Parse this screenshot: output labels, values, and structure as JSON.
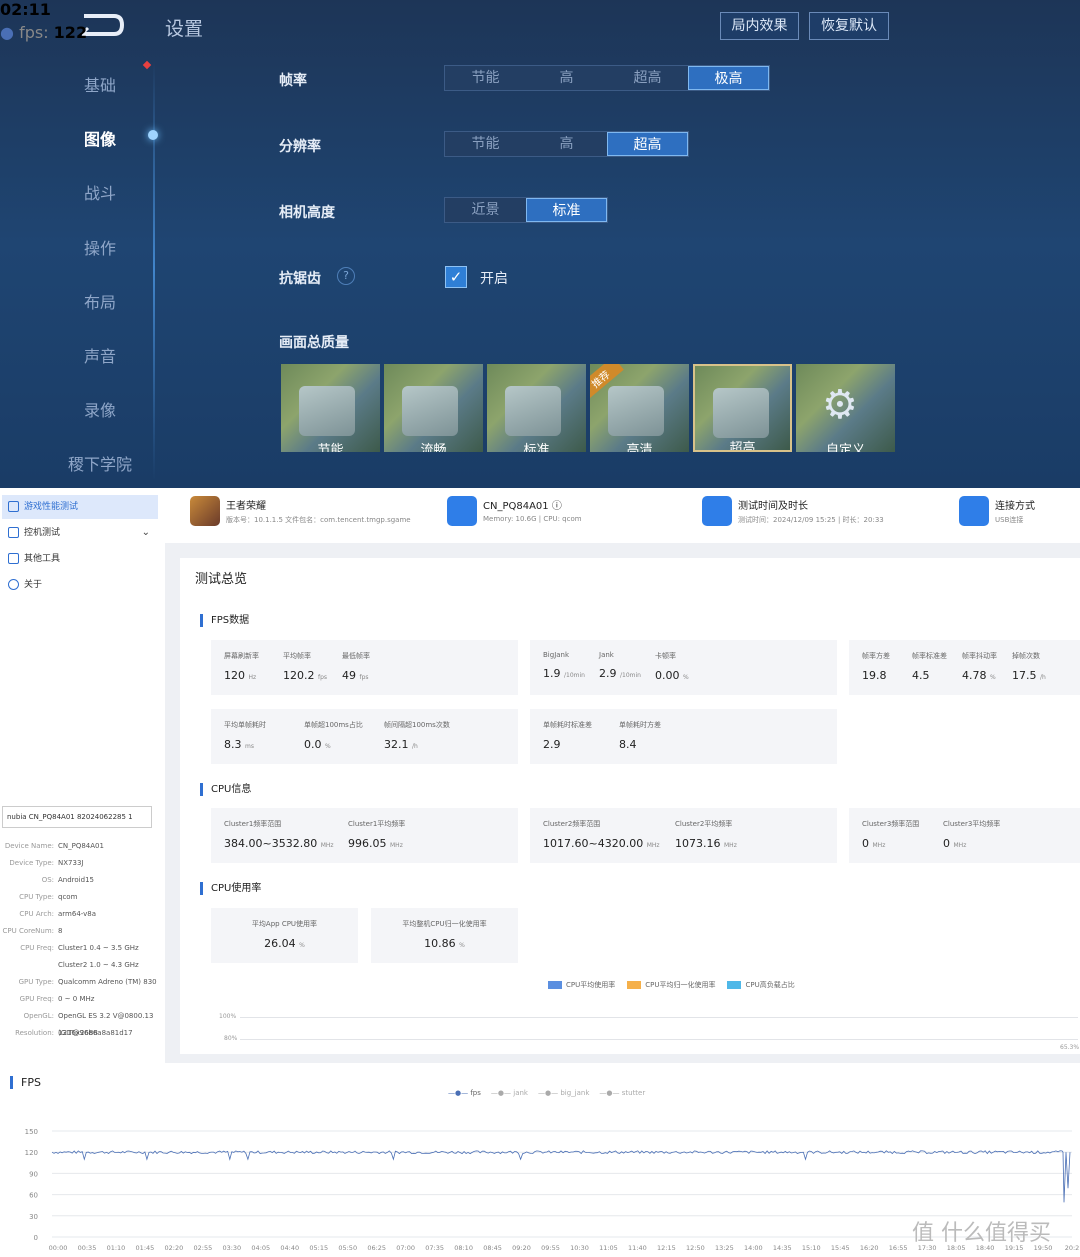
{
  "game": {
    "title": "设置",
    "top_buttons": [
      "局内效果",
      "恢复默认"
    ],
    "nav": [
      "基础",
      "图像",
      "战斗",
      "操作",
      "布局",
      "声音",
      "录像",
      "稷下学院"
    ],
    "active_nav": "图像",
    "settings": [
      {
        "label": "帧率",
        "options": [
          "节能",
          "高",
          "超高",
          "极高"
        ],
        "selected": "极高"
      },
      {
        "label": "分辨率",
        "options": [
          "节能",
          "高",
          "超高"
        ],
        "selected": "超高"
      },
      {
        "label": "相机高度",
        "options": [
          "近景",
          "标准"
        ],
        "selected": "标准"
      }
    ],
    "antialias": {
      "label": "抗锯齿",
      "help": "?",
      "checked": true,
      "value_label": "开启"
    },
    "quality": {
      "label": "画面总质量",
      "presets": [
        "节能",
        "流畅",
        "标准",
        "高清",
        "超高",
        "自定义"
      ],
      "selected": "超高",
      "recommended_badge": "推荐"
    }
  },
  "perf": {
    "sidebar": {
      "items": [
        "游戏性能测试",
        "控机测试",
        "其他工具",
        "关于"
      ],
      "active": "游戏性能测试",
      "device_select": "nubia CN_PQ84A01 82024062285 1",
      "device_info": [
        {
          "k": "Device Name:",
          "v": "CN_PQ84A01"
        },
        {
          "k": "Device Type:",
          "v": "NX733J"
        },
        {
          "k": "OS:",
          "v": "Android15"
        },
        {
          "k": "CPU Type:",
          "v": "qcom"
        },
        {
          "k": "CPU Arch:",
          "v": "arm64-v8a"
        },
        {
          "k": "CPU CoreNum:",
          "v": "8"
        },
        {
          "k": "CPU Freq:",
          "v": "Cluster1 0.4 ~ 3.5 GHz"
        },
        {
          "k": "",
          "v": "Cluster2 1.0 ~ 4.3 GHz"
        },
        {
          "k": "GPU Type:",
          "v": "Qualcomm Adreno (TM) 830"
        },
        {
          "k": "GPU Freq:",
          "v": "0 ~ 0 MHz"
        },
        {
          "k": "OpenGL:",
          "v": "OpenGL ES 3.2 V@0800.13 (GIT@96b6a8a81d17"
        },
        {
          "k": "Resolution:",
          "v": "1216x2688"
        }
      ]
    },
    "header": [
      {
        "title": "王者荣耀",
        "sub": "版本号：10.1.1.5    文件包名：com.tencent.tmgp.sgame",
        "icon": "game-avatar-icon"
      },
      {
        "title": "CN_PQ84A01 ⓘ",
        "sub": "Memory: 10.6G  |  CPU: qcom",
        "icon": "phone-icon"
      },
      {
        "title": "测试时间及时长",
        "sub": "测试时间：2024/12/09 15:25  |  时长：20:33",
        "icon": "clock-icon"
      },
      {
        "title": "连接方式",
        "sub": "USB连接",
        "icon": "usb-icon"
      }
    ],
    "overview_title": "测试总览",
    "fps_section": "FPS数据",
    "fps_metrics": {
      "box1": [
        {
          "label": "屏幕刷新率",
          "value": "120",
          "unit": "Hz"
        },
        {
          "label": "平均帧率",
          "value": "120.2",
          "unit": "fps"
        },
        {
          "label": "最低帧率",
          "value": "49",
          "unit": "fps"
        }
      ],
      "box2": [
        {
          "label": "BigJank",
          "value": "1.9",
          "unit": "/10min"
        },
        {
          "label": "Jank",
          "value": "2.9",
          "unit": "/10min"
        },
        {
          "label": "卡顿率",
          "value": "0.00",
          "unit": "%"
        }
      ],
      "box3": [
        {
          "label": "帧率方差",
          "value": "19.8",
          "unit": ""
        },
        {
          "label": "帧率标准差",
          "value": "4.5",
          "unit": ""
        },
        {
          "label": "帧率抖动率",
          "value": "4.78",
          "unit": "%"
        },
        {
          "label": "掉帧次数",
          "value": "17.5",
          "unit": "/h"
        }
      ],
      "box4": [
        {
          "label": "平均单帧耗时",
          "value": "8.3",
          "unit": "ms"
        },
        {
          "label": "单帧超100ms占比",
          "value": "0.0",
          "unit": "%"
        },
        {
          "label": "帧间隔超100ms次数",
          "value": "32.1",
          "unit": "/h"
        }
      ],
      "box5": [
        {
          "label": "单帧耗时标准差",
          "value": "2.9",
          "unit": ""
        },
        {
          "label": "单帧耗时方差",
          "value": "8.4",
          "unit": ""
        }
      ]
    },
    "cpu_section": "CPU信息",
    "cpu_metrics": {
      "box1": [
        {
          "label": "Cluster1频率范围",
          "value": "384.00~3532.80",
          "unit": "MHz"
        },
        {
          "label": "Cluster1平均频率",
          "value": "996.05",
          "unit": "MHz"
        }
      ],
      "box2": [
        {
          "label": "Cluster2频率范围",
          "value": "1017.60~4320.00",
          "unit": "MHz"
        },
        {
          "label": "Cluster2平均频率",
          "value": "1073.16",
          "unit": "MHz"
        }
      ],
      "box3": [
        {
          "label": "Cluster3频率范围",
          "value": "0",
          "unit": "MHz"
        },
        {
          "label": "Cluster3平均频率",
          "value": "0",
          "unit": "MHz"
        }
      ]
    },
    "cpu_usage_section": "CPU使用率",
    "cpu_usage": [
      {
        "label": "平均App CPU使用率",
        "value": "26.04",
        "unit": "%"
      },
      {
        "label": "平均整机CPU归一化使用率",
        "value": "10.86",
        "unit": "%"
      }
    ],
    "cpu_legend": [
      "CPU平均使用率",
      "CPU平均归一化使用率",
      "CPU高负载占比"
    ],
    "cpu_legend_colors": [
      "#5b8fe0",
      "#f5b04a",
      "#4fb8e8"
    ],
    "cpu_chart_ticks": [
      "100%",
      "80%"
    ],
    "cpu_chart_value": "65.3%",
    "fps_title": "FPS",
    "fps_legend": [
      "fps",
      "jank",
      "big_jank",
      "stutter"
    ],
    "tooltip": {
      "time": "02:11",
      "series": "fps:",
      "value": "122"
    }
  },
  "chart_data": {
    "type": "line",
    "title": "FPS",
    "series": [
      {
        "name": "fps",
        "summary": {
          "typical": 120,
          "min": 49
        }
      }
    ],
    "ylim": [
      0,
      150
    ],
    "y_ticks": [
      0,
      30,
      60,
      90,
      120,
      150
    ],
    "x_ticks": [
      "00:00",
      "00:35",
      "01:10",
      "01:45",
      "02:20",
      "02:55",
      "03:30",
      "04:05",
      "04:40",
      "05:15",
      "05:50",
      "06:25",
      "07:00",
      "07:35",
      "08:10",
      "08:45",
      "09:20",
      "09:55",
      "10:30",
      "11:05",
      "11:40",
      "12:15",
      "12:50",
      "13:25",
      "14:00",
      "14:35",
      "15:10",
      "15:45",
      "16:20",
      "16:55",
      "17:30",
      "18:05",
      "18:40",
      "19:15",
      "19:50",
      "20:2"
    ],
    "grid": true,
    "legend": "top-center"
  },
  "watermark": "值 什么值得买"
}
